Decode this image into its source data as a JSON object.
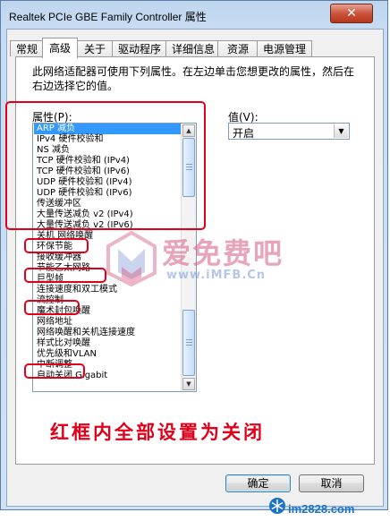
{
  "window": {
    "title": "Realtek PCIe GBE Family Controller 属性",
    "close_glyph": "✕"
  },
  "tabs": [
    {
      "label": "常规"
    },
    {
      "label": "高级"
    },
    {
      "label": "关于"
    },
    {
      "label": "驱动程序"
    },
    {
      "label": "详细信息"
    },
    {
      "label": "资源"
    },
    {
      "label": "电源管理"
    }
  ],
  "active_tab": "高级",
  "description": "此网络适配器可使用下列属性。在左边单击您想更改的属性，然后在右边选择它的值。",
  "property_label": "属性(P):",
  "value_label": "值(V):",
  "properties": [
    "ARP 减负",
    "IPv4 硬件校验和",
    "NS 减负",
    "TCP 硬件校验和 (IPv4)",
    "TCP 硬件校验和 (IPv6)",
    "UDP 硬件校验和 (IPv4)",
    "UDP 硬件校验和 (IPv6)",
    "传送缓冲区",
    "大量传送减负 v2 (IPv4)",
    "大量传送减负 v2 (IPv6)",
    "关机 网络唤醒",
    "环保节能",
    "接收缓冲器",
    "节能乙太网路",
    "巨型帧",
    "连接速度和双工模式",
    "流控制",
    "魔术封包唤醒",
    "网络地址",
    "网络唤醒和关机连接速度",
    "样式比对唤醒",
    "优先级和VLAN",
    "中断调整",
    "自动关闭 Gigabit"
  ],
  "selected_property": "ARP 减负",
  "value_select": {
    "selected": "开启"
  },
  "watermark": {
    "text": "爱免费吧",
    "url": "www.iMFB.Cn"
  },
  "caption": "红框内全部设置为关闭",
  "buttons": {
    "ok": "确定",
    "cancel": "取消"
  },
  "footer": {
    "site": "im2828.com"
  },
  "colors": {
    "highlight": "#3399ff",
    "annotation_red": "#e0001a",
    "footer_blue": "#1a73c9"
  },
  "icons": {
    "close": "close-icon",
    "scroll_up": "scroll-up-arrow-icon",
    "scroll_down": "scroll-down-arrow-icon",
    "dropdown": "chevron-down-icon",
    "logo": "snowflake-logo-icon"
  }
}
